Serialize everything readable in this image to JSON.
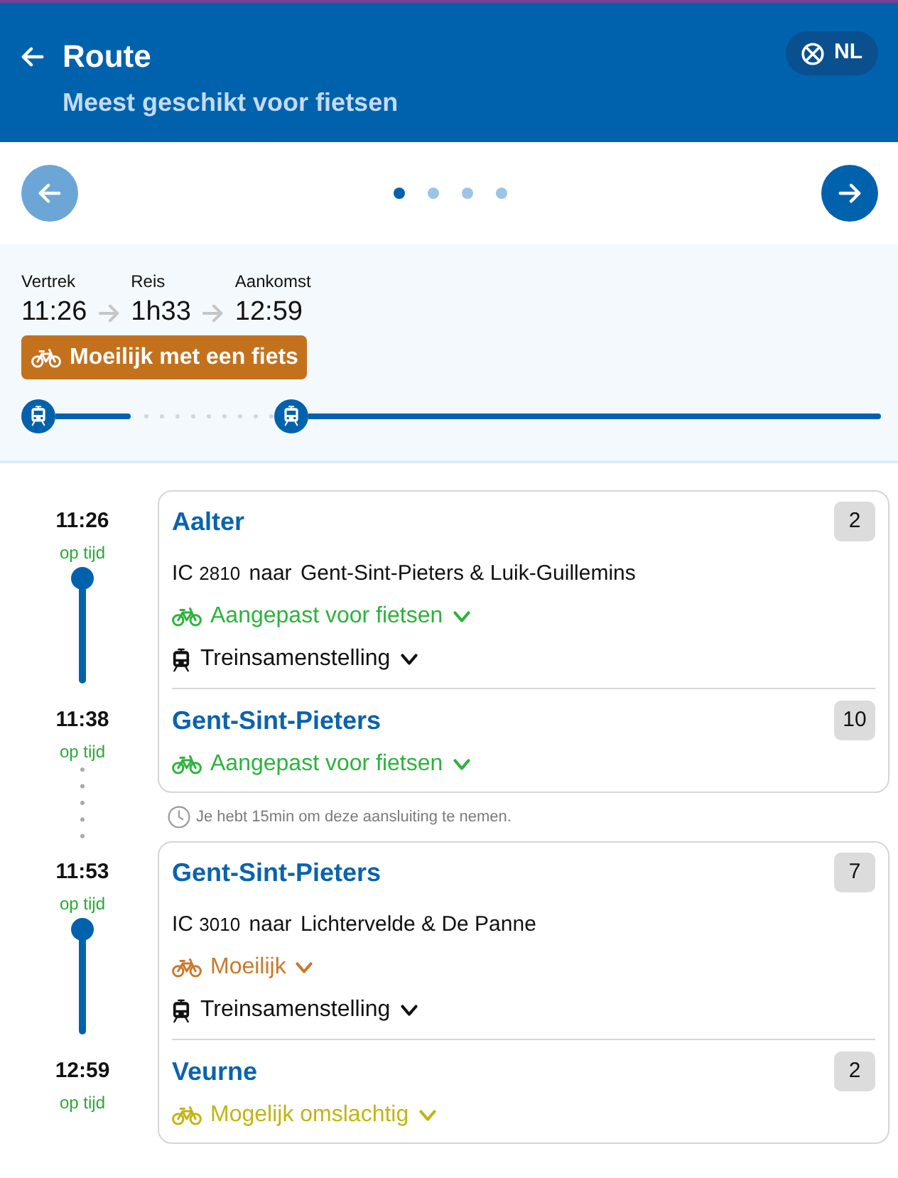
{
  "header": {
    "title": "Route",
    "subtitle": "Meest geschikt voor fietsen",
    "language": "NL"
  },
  "pager": {
    "previous": {
      "disabled": true
    },
    "next": {
      "disabled": false
    },
    "pages": [
      {
        "selected": true
      },
      {
        "selected": false
      },
      {
        "selected": false
      },
      {
        "selected": false
      }
    ]
  },
  "summary": {
    "items": [
      {
        "label": "Vertrek",
        "time": "11:26"
      },
      {
        "label": "Reis",
        "time": "1h33"
      },
      {
        "label": "Aankomst",
        "time": "12:59"
      }
    ],
    "bike_badge": {
      "label": "Moeilijk met een fiets",
      "color": "#c4711e"
    },
    "segments": [
      {
        "kind": "train"
      },
      {
        "kind": "transfer"
      },
      {
        "kind": "train"
      }
    ]
  },
  "journey": [
    {
      "kind": "leg",
      "departure": {
        "time": "11:26",
        "status": "op tijd",
        "station": "Aalter",
        "platform": "2"
      },
      "train": {
        "type": "IC",
        "number": "2810",
        "word": "naar",
        "destination": "Gent-Sint-Pieters & Luik-Guillemins"
      },
      "bike_access": {
        "label": "Aangepast voor fietsen",
        "color": "#2db33c",
        "expanded": false
      },
      "composition": {
        "label": "Treinsamenstelling",
        "expanded": false
      },
      "arrival": {
        "time": "11:38",
        "status": "op tijd",
        "station": "Gent-Sint-Pieters",
        "platform": "10",
        "bike_access": {
          "label": "Aangepast voor fietsen",
          "color": "#2db33c",
          "expanded": false
        }
      }
    },
    {
      "kind": "transfer",
      "note": "Je hebt 15min om deze aansluiting te nemen."
    },
    {
      "kind": "leg",
      "departure": {
        "time": "11:53",
        "status": "op tijd",
        "station": "Gent-Sint-Pieters",
        "platform": "7"
      },
      "train": {
        "type": "IC",
        "number": "3010",
        "word": "naar",
        "destination": "Lichtervelde & De Panne"
      },
      "bike_access": {
        "label": "Moeilijk",
        "color": "#c97a2a",
        "expanded": false
      },
      "composition": {
        "label": "Treinsamenstelling",
        "expanded": false
      },
      "arrival": {
        "time": "12:59",
        "status": "op tijd",
        "station": "Veurne",
        "platform": "2",
        "bike_access": {
          "label": "Mogelijk omslachtig",
          "color": "#c2b512",
          "expanded": false
        }
      }
    }
  ]
}
